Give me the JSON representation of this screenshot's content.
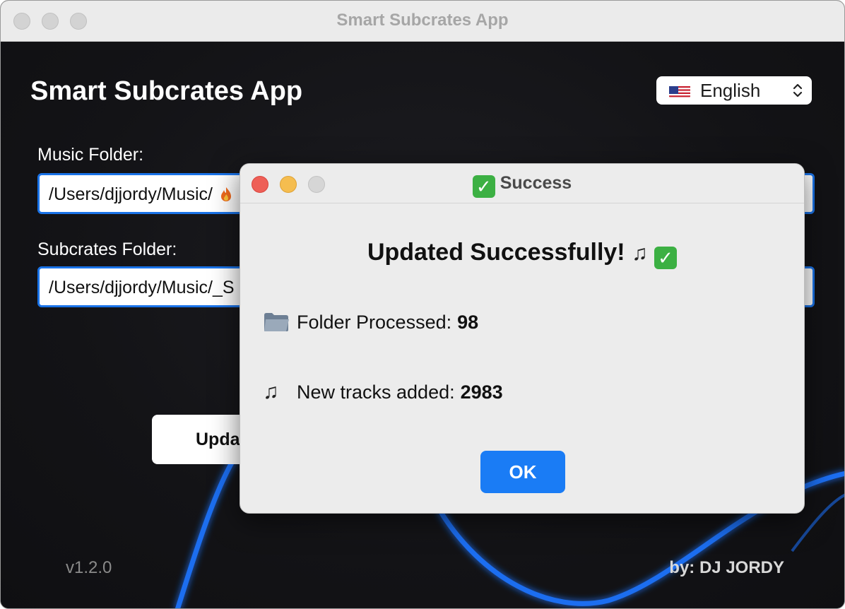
{
  "window": {
    "title": "Smart Subcrates App"
  },
  "app": {
    "title": "Smart Subcrates App",
    "language": {
      "selected": "English",
      "flag": "us-flag-icon"
    },
    "music_folder": {
      "label": "Music Folder:",
      "value": "/Users/djjordy/Music/"
    },
    "subcrates_folder": {
      "label": "Subcrates Folder:",
      "value": "/Users/djjordy/Music/_S"
    },
    "update_button_label": "Upda",
    "version": "v1.2.0",
    "author": "by: DJ JORDY"
  },
  "dialog": {
    "title": "Success",
    "heading": "Updated Successfully!",
    "lines": [
      {
        "label": "Folder Processed:",
        "value": "98",
        "icon": "folder-icon"
      },
      {
        "label": "New tracks added:",
        "value": "2983",
        "icon": "music-notes-icon"
      }
    ],
    "ok_label": "OK"
  },
  "colors": {
    "accent": "#1a7cf5",
    "field_border": "#1a73e8",
    "success": "#3cb043",
    "close": "#ee5f57",
    "minimize": "#f5bd4f",
    "dialog_bg": "#ececec",
    "app_bg": "#131315"
  }
}
